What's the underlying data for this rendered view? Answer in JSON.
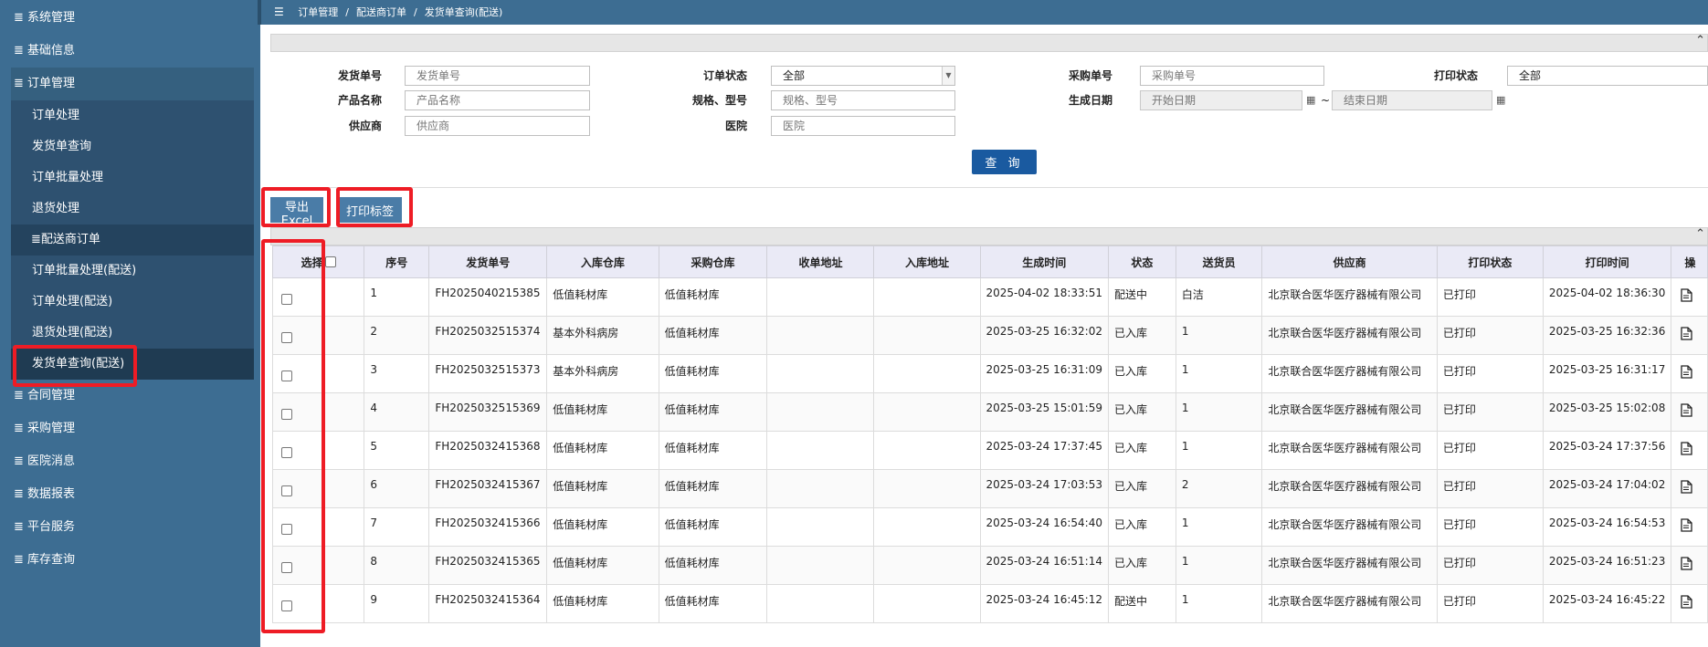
{
  "sidebar": {
    "items": [
      {
        "label": "系统管理",
        "icon": "list-icon"
      },
      {
        "label": "基础信息",
        "icon": "list-icon"
      },
      {
        "label": "订单管理",
        "icon": "list-icon"
      }
    ],
    "sub_items": [
      {
        "label": "订单处理"
      },
      {
        "label": "发货单查询"
      },
      {
        "label": "订单批量处理"
      },
      {
        "label": "退货处理"
      },
      {
        "label": "配送商订单",
        "icon": "list-icon"
      },
      {
        "label": "订单批量处理(配送)"
      },
      {
        "label": "订单处理(配送)"
      },
      {
        "label": "退货处理(配送)"
      },
      {
        "label": "发货单查询(配送)"
      }
    ],
    "items_after": [
      {
        "label": "合同管理"
      },
      {
        "label": "采购管理"
      },
      {
        "label": "医院消息"
      },
      {
        "label": "数据报表"
      },
      {
        "label": "平台服务"
      },
      {
        "label": "库存查询"
      }
    ]
  },
  "breadcrumb": {
    "icon": "menu-icon",
    "parts": [
      "订单管理",
      "配送商订单",
      "发货单查询(配送)"
    ],
    "separator": "/"
  },
  "filters": {
    "ship_no_label": "发货单号",
    "ship_no_placeholder": "发货单号",
    "order_status_label": "订单状态",
    "order_status_value": "全部",
    "purchase_no_label": "采购单号",
    "purchase_no_placeholder": "采购单号",
    "print_status_label": "打印状态",
    "print_status_value": "全部",
    "product_label": "产品名称",
    "product_placeholder": "产品名称",
    "spec_label": "规格、型号",
    "spec_placeholder": "规格、型号",
    "gen_date_label": "生成日期",
    "start_placeholder": "开始日期",
    "end_placeholder": "结束日期",
    "date_separator": "~",
    "supplier_label": "供应商",
    "supplier_placeholder": "供应商",
    "hospital_label": "医院",
    "hospital_placeholder": "医院",
    "search_button": "查 询"
  },
  "toolbar": {
    "export_label": "导出Excel",
    "print_label": "打印标签"
  },
  "table": {
    "columns": [
      "选择",
      "序号",
      "发货单号",
      "入库仓库",
      "采购仓库",
      "收单地址",
      "入库地址",
      "生成时间",
      "状态",
      "送货员",
      "供应商",
      "打印状态",
      "打印时间",
      "操"
    ],
    "rows": [
      [
        "1",
        "FH2025040215385",
        "低值耗材库",
        "低值耗材库",
        "",
        "",
        "2025-04-02 18:33:51",
        "配送中",
        "白洁",
        "北京联合医华医疗器械有限公司",
        "已打印",
        "2025-04-02 18:36:30"
      ],
      [
        "2",
        "FH2025032515374",
        "基本外科病房",
        "低值耗材库",
        "",
        "",
        "2025-03-25 16:32:02",
        "已入库",
        "1",
        "北京联合医华医疗器械有限公司",
        "已打印",
        "2025-03-25 16:32:36"
      ],
      [
        "3",
        "FH2025032515373",
        "基本外科病房",
        "低值耗材库",
        "",
        "",
        "2025-03-25 16:31:09",
        "已入库",
        "1",
        "北京联合医华医疗器械有限公司",
        "已打印",
        "2025-03-25 16:31:17"
      ],
      [
        "4",
        "FH2025032515369",
        "低值耗材库",
        "低值耗材库",
        "",
        "",
        "2025-03-25 15:01:59",
        "已入库",
        "1",
        "北京联合医华医疗器械有限公司",
        "已打印",
        "2025-03-25 15:02:08"
      ],
      [
        "5",
        "FH2025032415368",
        "低值耗材库",
        "低值耗材库",
        "",
        "",
        "2025-03-24 17:37:45",
        "已入库",
        "1",
        "北京联合医华医疗器械有限公司",
        "已打印",
        "2025-03-24 17:37:56"
      ],
      [
        "6",
        "FH2025032415367",
        "低值耗材库",
        "低值耗材库",
        "",
        "",
        "2025-03-24 17:03:53",
        "已入库",
        "2",
        "北京联合医华医疗器械有限公司",
        "已打印",
        "2025-03-24 17:04:02"
      ],
      [
        "7",
        "FH2025032415366",
        "低值耗材库",
        "低值耗材库",
        "",
        "",
        "2025-03-24 16:54:40",
        "已入库",
        "1",
        "北京联合医华医疗器械有限公司",
        "已打印",
        "2025-03-24 16:54:53"
      ],
      [
        "8",
        "FH2025032415365",
        "低值耗材库",
        "低值耗材库",
        "",
        "",
        "2025-03-24 16:51:14",
        "已入库",
        "1",
        "北京联合医华医疗器械有限公司",
        "已打印",
        "2025-03-24 16:51:23"
      ],
      [
        "9",
        "FH2025032415364",
        "低值耗材库",
        "低值耗材库",
        "",
        "",
        "2025-03-24 16:45:12",
        "配送中",
        "1",
        "北京联合医华医疗器械有限公司",
        "已打印",
        "2025-03-24 16:45:22"
      ]
    ]
  },
  "colors": {
    "sidebar_bg": "#3d6d92",
    "primary_button": "#1a5aa0",
    "highlight": "#ee1c25"
  }
}
